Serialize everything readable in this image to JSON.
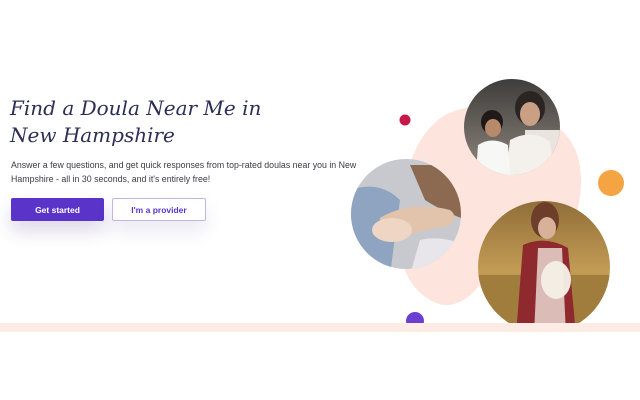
{
  "hero": {
    "title": "Find a Doula Near Me in New Hampshire",
    "description": "Answer a few questions, and get quick responses from top-rated doulas near you in New Hampshire - all in 30 seconds, and it's entirely free!",
    "primary_button": "Get started",
    "secondary_button": "I'm a provider"
  },
  "colors": {
    "brand_purple": "#5a33c8",
    "title_navy": "#2b2f55",
    "blush": "#fde4dc",
    "accent_orange": "#f5a443",
    "accent_crimson": "#c8184a"
  },
  "images": [
    {
      "name": "mother-and-child-photo"
    },
    {
      "name": "baby-hand-holding-finger-photo"
    },
    {
      "name": "pregnant-woman-outdoors-photo"
    }
  ]
}
